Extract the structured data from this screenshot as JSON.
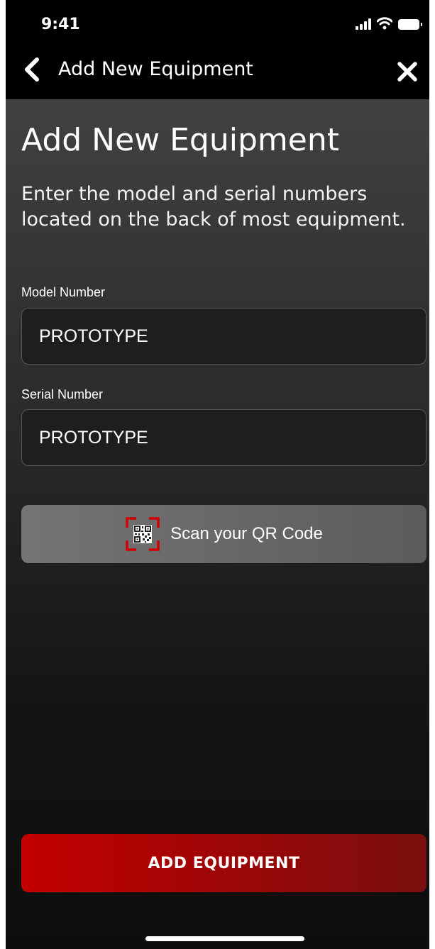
{
  "status_bar": {
    "time": "9:41"
  },
  "nav": {
    "title": "Add New Equipment",
    "back_icon": "chevron-left-icon",
    "close_icon": "close-icon"
  },
  "main": {
    "title": "Add New Equipment",
    "description": "Enter the model and serial numbers located on the back of most equipment.",
    "model_field": {
      "label": "Model Number",
      "value": "PROTOTYPE"
    },
    "serial_field": {
      "label": "Serial Number",
      "value": "PROTOTYPE"
    },
    "scan_button": {
      "label": "Scan your QR Code",
      "icon": "qr-code-icon"
    },
    "add_button": {
      "label": "ADD EQUIPMENT"
    }
  },
  "colors": {
    "accent_red": "#c40000",
    "header_bg": "#000000",
    "field_bg": "#1e1e1e"
  }
}
